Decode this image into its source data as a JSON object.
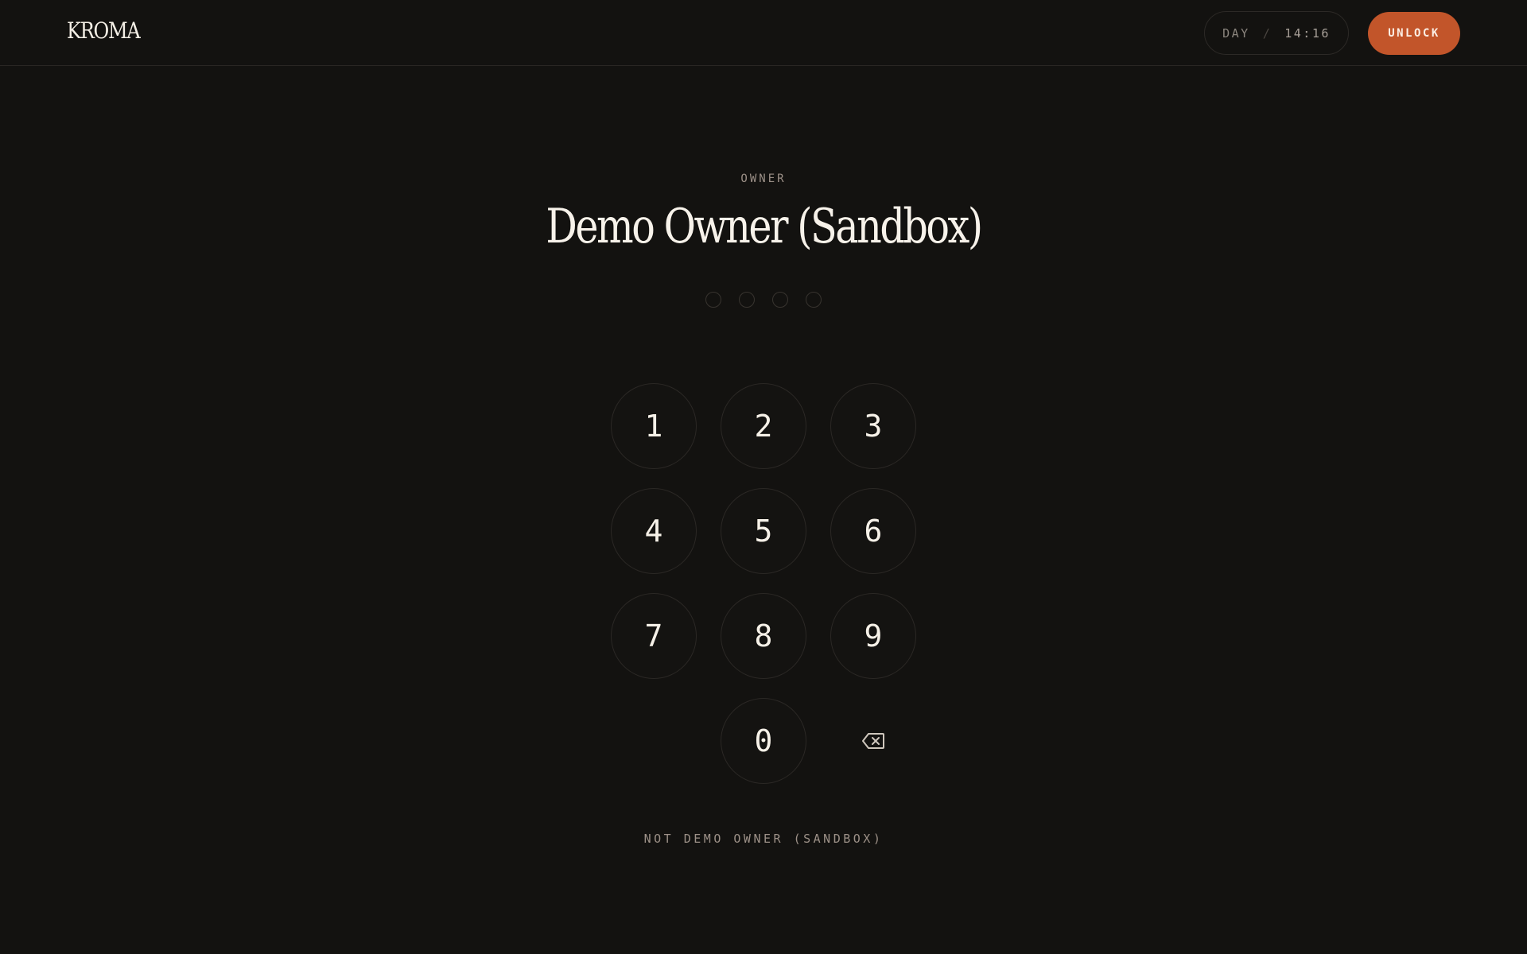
{
  "header": {
    "logo": "KROMA",
    "clock_mode": "DAY",
    "clock_separator": "/",
    "clock_time": "14:16",
    "unlock_label": "UNLOCK"
  },
  "lock": {
    "role_label": "OWNER",
    "owner_name": "Demo Owner (Sandbox)",
    "pin_length": 4,
    "pin_entered": 0,
    "keys": [
      "1",
      "2",
      "3",
      "4",
      "5",
      "6",
      "7",
      "8",
      "9",
      "0"
    ],
    "backspace_icon": "backspace-icon",
    "not_user_link": "NOT DEMO OWNER (SANDBOX)"
  },
  "colors": {
    "background": "#131210",
    "accent": "#c2552a",
    "text": "#f4efe6",
    "muted": "#9d9188"
  }
}
